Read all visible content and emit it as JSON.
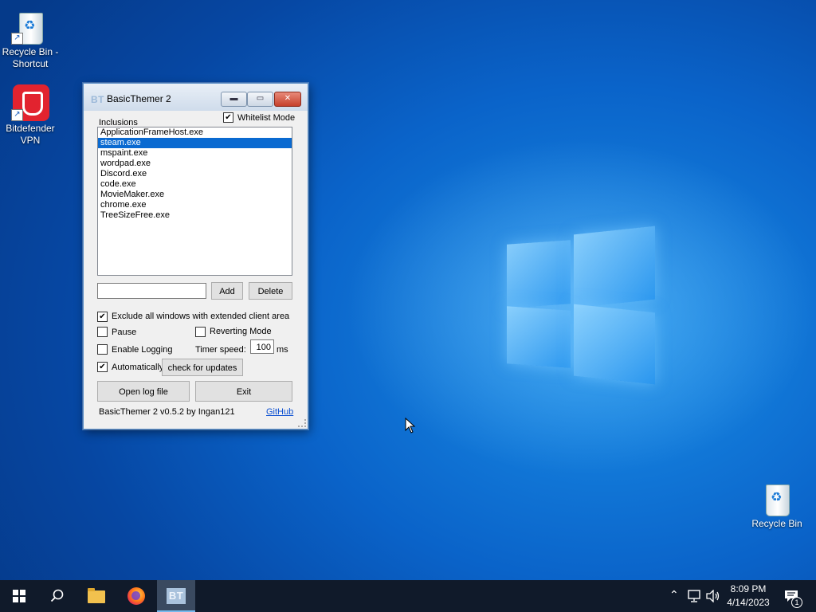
{
  "desktop": {
    "icons": [
      {
        "label": "Recycle Bin - Shortcut"
      },
      {
        "label": "Bitdefender VPN"
      },
      {
        "label": "Recycle Bin"
      }
    ]
  },
  "window": {
    "title": "BasicThemer 2",
    "icon_text": "BT",
    "whitelist_mode_label": "Whitelist Mode",
    "whitelist_mode_checked": true,
    "inclusions_label": "Inclusions",
    "inclusions": [
      "ApplicationFrameHost.exe",
      "steam.exe",
      "mspaint.exe",
      "wordpad.exe",
      "Discord.exe",
      "code.exe",
      "MovieMaker.exe",
      "chrome.exe",
      "TreeSizeFree.exe"
    ],
    "selected_inclusion": "steam.exe",
    "new_entry_value": "",
    "add_label": "Add",
    "delete_label": "Delete",
    "exclude_label": "Exclude all windows with extended client area",
    "exclude_checked": true,
    "pause_label": "Pause",
    "pause_checked": false,
    "reverting_label": "Reverting Mode",
    "reverting_checked": false,
    "logging_label": "Enable Logging",
    "logging_checked": false,
    "timer_label": "Timer speed:",
    "timer_value": "100",
    "timer_unit": "ms",
    "auto_label": "Automatically",
    "auto_checked": true,
    "check_updates_label": "check for updates",
    "open_log_label": "Open log file",
    "exit_label": "Exit",
    "version_label": "BasicThemer 2 v0.5.2 by Ingan121",
    "github_label": "GitHub"
  },
  "taskbar": {
    "pinned": [
      "start-button",
      "search",
      "file-explorer",
      "firefox",
      "basicthemer"
    ],
    "active_app_text": "BT",
    "time": "8:09 PM",
    "date": "4/14/2023",
    "notification_count": "1"
  }
}
